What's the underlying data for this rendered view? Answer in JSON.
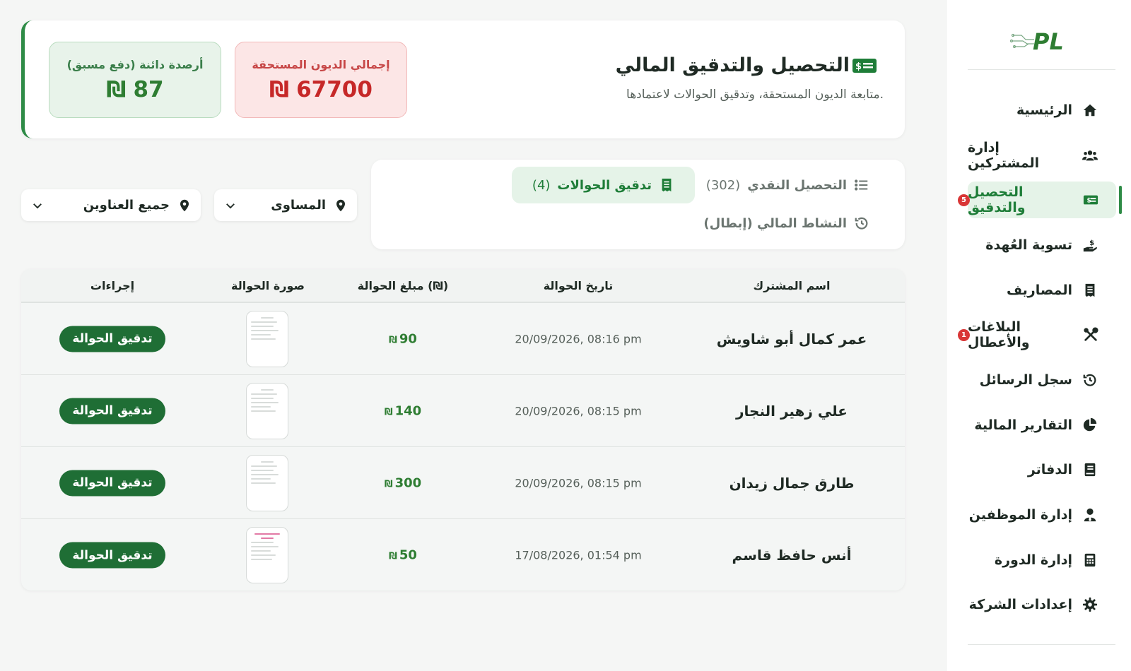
{
  "sidebar": {
    "logo_text": "PL",
    "items": [
      {
        "label": "الرئيسية",
        "icon": "home-icon"
      },
      {
        "label": "إدارة المشتركين",
        "icon": "users-icon"
      },
      {
        "label": "التحصيل والتدقيق",
        "icon": "money-bill-icon",
        "active": true,
        "badge": "5"
      },
      {
        "label": "تسوية العُهدة",
        "icon": "hand-holding-dollar-icon"
      },
      {
        "label": "المصاريف",
        "icon": "receipt-icon"
      },
      {
        "label": "البلاغات والأعطال",
        "icon": "tools-icon",
        "badge": "1"
      },
      {
        "label": "سجل الرسائل",
        "icon": "history-icon"
      },
      {
        "label": "التقارير المالية",
        "icon": "pie-chart-icon"
      },
      {
        "label": "الدفاتر",
        "icon": "book-icon"
      },
      {
        "label": "إدارة الموظفين",
        "icon": "user-tie-icon"
      },
      {
        "label": "إدارة الدورة",
        "icon": "calculator-icon"
      },
      {
        "label": "إعدادات الشركة",
        "icon": "gear-icon"
      }
    ]
  },
  "header": {
    "title": "التحصيل والتدقيق المالي",
    "subtitle": "متابعة الديون المستحقة، وتدقيق الحوالات لاعتمادها.",
    "stats": {
      "debts_label": "إجمالي الديون المستحقة",
      "debts_value": "67700",
      "credits_label": "أرصدة دائنة (دفع مسبق)",
      "credits_value": "87",
      "currency": "₪"
    }
  },
  "tabs": {
    "cash_label": "التحصيل النقدي",
    "cash_count": "(302)",
    "transfers_label": "تدقيق الحوالات",
    "transfers_count": "(4)",
    "activity_label": "النشاط المالي (إبطال)"
  },
  "filters": {
    "region": "المساوى",
    "address": "جميع العناوين"
  },
  "table": {
    "headers": {
      "name": "اسم المشترك",
      "date": "تاريخ الحوالة",
      "amount": "مبلغ الحوالة (₪)",
      "image": "صورة الحوالة",
      "actions": "إجراءات"
    },
    "currency": "₪",
    "action_label": "تدقيق الحوالة",
    "rows": [
      {
        "name": "عمر كمال أبو شاويش",
        "date": "20/09/2026, 08:16 pm",
        "amount": "90"
      },
      {
        "name": "علي زهير النجار",
        "date": "20/09/2026, 08:15 pm",
        "amount": "140"
      },
      {
        "name": "طارق جمال زيدان",
        "date": "20/09/2026, 08:15 pm",
        "amount": "300"
      },
      {
        "name": "أنس حافظ قاسم",
        "date": "17/08/2026, 01:54 pm",
        "amount": "50"
      }
    ]
  },
  "colors": {
    "primary": "#2e8b46",
    "danger": "#c62828",
    "active_bg": "#e5f3e8",
    "button": "#1f6e35"
  }
}
